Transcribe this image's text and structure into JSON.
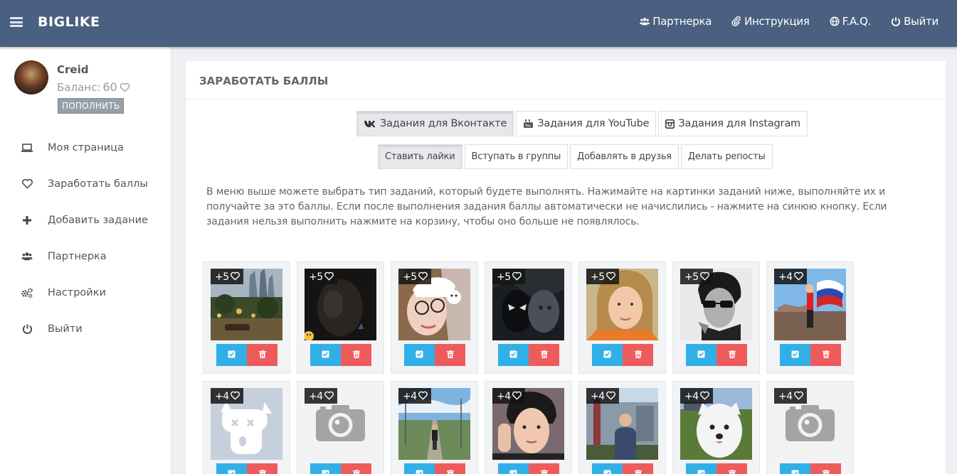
{
  "header": {
    "brand": "BIGLIKE",
    "nav": [
      {
        "label": "Партнерка",
        "icon": "users-icon"
      },
      {
        "label": "Инструкция",
        "icon": "paperclip-icon"
      },
      {
        "label": "F.A.Q.",
        "icon": "globe-icon"
      },
      {
        "label": "Выйти",
        "icon": "power-icon"
      }
    ]
  },
  "sidebar": {
    "user": {
      "name": "Creid",
      "balance_label": "Баланс:",
      "balance": "60",
      "topup": "ПОПОЛНИТЬ"
    },
    "items": [
      {
        "label": "Моя страница",
        "icon": "laptop-icon"
      },
      {
        "label": "Заработать баллы",
        "icon": "heart-icon"
      },
      {
        "label": "Добавить задание",
        "icon": "plus-icon"
      },
      {
        "label": "Партнерка",
        "icon": "users-icon"
      },
      {
        "label": "Настройки",
        "icon": "cogs-icon"
      },
      {
        "label": "Выйти",
        "icon": "power-icon"
      }
    ]
  },
  "main": {
    "title": "ЗАРАБОТАТЬ БАЛЛЫ",
    "tabs": [
      {
        "label": "Задания для Вконтакте",
        "icon": "vk-icon",
        "active": true
      },
      {
        "label": "Задания для YouTube",
        "icon": "youtube-icon",
        "active": false
      },
      {
        "label": "Задания для Instagram",
        "icon": "instagram-icon",
        "active": false
      }
    ],
    "subtabs": [
      {
        "label": "Ставить лайки",
        "active": true
      },
      {
        "label": "Вступать в группы",
        "active": false
      },
      {
        "label": "Добавлять в друзья",
        "active": false
      },
      {
        "label": "Делать репосты",
        "active": false
      }
    ],
    "description": "В меню выше можете выбрать тип заданий, который будете выполнять. Нажимайте на картинки заданий ниже, выполняйте их и получайте за это баллы. Если после выполнения задания баллы автоматически не начислились - нажмите на синюю кнопку. Если задания нельзя выполнить нажмите на корзину, чтобы оно больше не появлялось.",
    "tasks": [
      {
        "points": "+5",
        "image": "city-night-photo"
      },
      {
        "points": "+5",
        "image": "dark-selfie-photo"
      },
      {
        "points": "+5",
        "image": "girl-with-cat-filter-photo"
      },
      {
        "points": "+5",
        "image": "venom-art-photo"
      },
      {
        "points": "+5",
        "image": "girl-portrait-photo"
      },
      {
        "points": "+5",
        "image": "bw-man-sunglasses-photo"
      },
      {
        "points": "+4",
        "image": "man-with-flag-photo"
      },
      {
        "points": "+4",
        "image": "deleted-dog-avatar"
      },
      {
        "points": "+4",
        "image": "camera-placeholder"
      },
      {
        "points": "+4",
        "image": "man-on-road-photo"
      },
      {
        "points": "+4",
        "image": "young-man-photo"
      },
      {
        "points": "+4",
        "image": "man-outdoors-photo"
      },
      {
        "points": "+4",
        "image": "white-dog-photo"
      },
      {
        "points": "+4",
        "image": "camera-placeholder"
      }
    ]
  },
  "colors": {
    "header": "#4a6080",
    "confirm": "#31b0e8",
    "delete": "#ee5b5b"
  }
}
